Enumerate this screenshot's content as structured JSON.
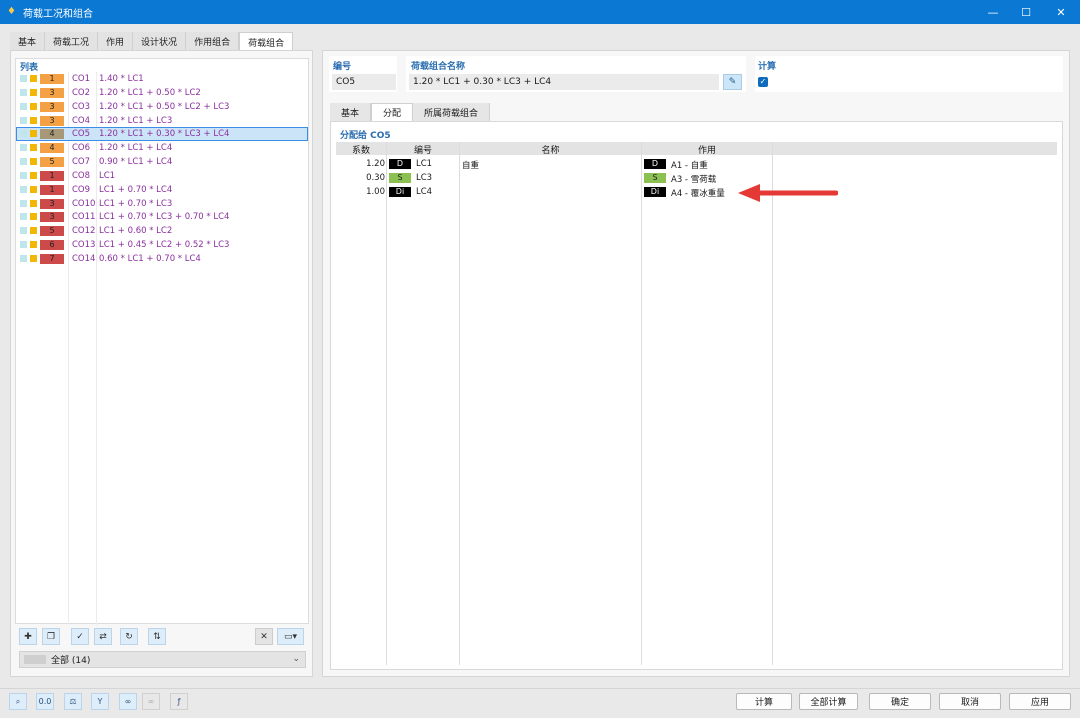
{
  "window": {
    "title": "荷载工况和组合"
  },
  "main_tabs": [
    {
      "label": "基本"
    },
    {
      "label": "荷载工况"
    },
    {
      "label": "作用"
    },
    {
      "label": "设计状况"
    },
    {
      "label": "作用组合"
    },
    {
      "label": "荷载组合"
    }
  ],
  "list": {
    "header": "列表",
    "items": [
      {
        "badge": "1",
        "badge_color": "#f4a145",
        "id": "CO1",
        "formula": "1.40 * LC1"
      },
      {
        "badge": "3",
        "badge_color": "#f4a145",
        "id": "CO2",
        "formula": "1.20 * LC1 + 0.50 * LC2"
      },
      {
        "badge": "3",
        "badge_color": "#f4a145",
        "id": "CO3",
        "formula": "1.20 * LC1 + 0.50 * LC2 + LC3"
      },
      {
        "badge": "3",
        "badge_color": "#f4a145",
        "id": "CO4",
        "formula": "1.20 * LC1 + LC3"
      },
      {
        "badge": "4",
        "badge_color": "#a89878",
        "id": "CO5",
        "formula": "1.20 * LC1 + 0.30 * LC3 + LC4",
        "selected": true
      },
      {
        "badge": "4",
        "badge_color": "#f4a145",
        "id": "CO6",
        "formula": "1.20 * LC1 + LC4"
      },
      {
        "badge": "5",
        "badge_color": "#f4a145",
        "id": "CO7",
        "formula": "0.90 * LC1 + LC4"
      },
      {
        "badge": "1",
        "badge_color": "#cc4a4a",
        "id": "CO8",
        "formula": "LC1"
      },
      {
        "badge": "1",
        "badge_color": "#cc4a4a",
        "id": "CO9",
        "formula": "LC1 + 0.70 * LC4"
      },
      {
        "badge": "3",
        "badge_color": "#cc4a4a",
        "id": "CO10",
        "formula": "LC1 + 0.70 * LC3"
      },
      {
        "badge": "3",
        "badge_color": "#cc4a4a",
        "id": "CO11",
        "formula": "LC1 + 0.70 * LC3 + 0.70 * LC4"
      },
      {
        "badge": "5",
        "badge_color": "#cc4a4a",
        "id": "CO12",
        "formula": "LC1 + 0.60 * LC2"
      },
      {
        "badge": "6",
        "badge_color": "#cc4a4a",
        "id": "CO13",
        "formula": "LC1 + 0.45 * LC2 + 0.52 * LC3"
      },
      {
        "badge": "7",
        "badge_color": "#cc4a4a",
        "id": "CO14",
        "formula": "0.60 * LC1 + 0.70 * LC4"
      }
    ],
    "filter": "全部 (14)"
  },
  "detail": {
    "number_label": "编号",
    "number_value": "CO5",
    "name_label": "荷载组合名称",
    "name_value": "1.20 * LC1 + 0.30 * LC3 + LC4",
    "calc_label": "计算",
    "calc_checked": true
  },
  "sub_tabs": [
    {
      "label": "基本"
    },
    {
      "label": "分配"
    },
    {
      "label": "所属荷载组合"
    }
  ],
  "assignment": {
    "title": "分配给 CO5",
    "headers": {
      "factor": "系数",
      "number": "编号",
      "name": "名称",
      "action": "作用"
    },
    "rows": [
      {
        "factor": "1.20",
        "lc_tag": "D",
        "lc": "LC1",
        "name": "自重",
        "action_tag": "D",
        "action": "A1 - 自重"
      },
      {
        "factor": "0.30",
        "lc_tag": "S",
        "lc": "LC3",
        "name": "",
        "action_tag": "S",
        "action": "A3 - 雪荷载"
      },
      {
        "factor": "1.00",
        "lc_tag": "Di",
        "lc": "LC4",
        "name": "",
        "action_tag": "Di",
        "action": "A4 - 覆冰重量"
      }
    ]
  },
  "buttons": {
    "calc": "计算",
    "calc_all": "全部计算",
    "ok": "确定",
    "cancel": "取消",
    "apply": "应用"
  },
  "colors": {
    "titlebar": "#0b78d4",
    "header_blue": "#2a6db0",
    "formula_purple": "#8a2f9e",
    "arrow_red": "#e53935"
  }
}
